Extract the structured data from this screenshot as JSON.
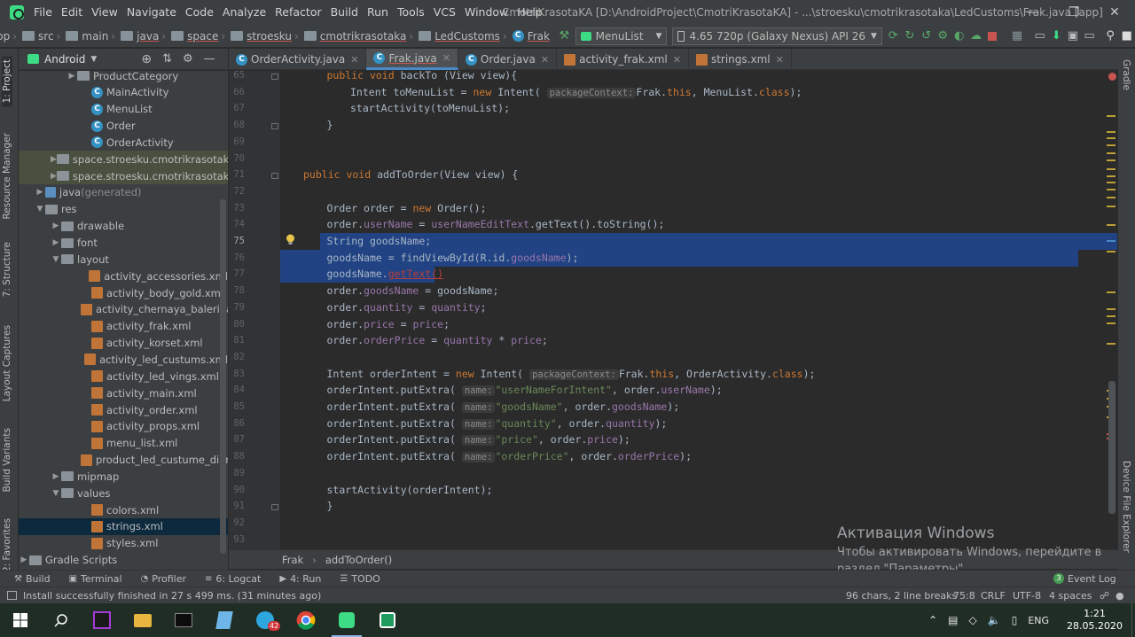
{
  "menubar": {
    "items": [
      "File",
      "Edit",
      "View",
      "Navigate",
      "Code",
      "Analyze",
      "Refactor",
      "Build",
      "Run",
      "Tools",
      "VCS",
      "Window",
      "Help"
    ],
    "window_title": "CmotriKrasotaKA [D:\\AndroidProject\\CmotriKrasotaKA] - ...\\stroesku\\cmotrikrasotaka\\LedCustoms\\Frak.java [app]"
  },
  "navbar": {
    "breadcrumbs": [
      "pp",
      "src",
      "main",
      "java",
      "space",
      "stroesku",
      "cmotrikrasotaka",
      "LedCustoms",
      "Frak"
    ],
    "run_config": "MenuList",
    "device": "4.65  720p (Galaxy Nexus) API 26"
  },
  "left_strip": {
    "tabs": [
      "1: Project",
      "Resource Manager",
      "7: Structure",
      "Layout Captures",
      "Build Variants",
      "2: Favorites"
    ]
  },
  "right_strip": {
    "tabs": [
      "Gradle",
      "Device File Explorer"
    ]
  },
  "project": {
    "view_label": "Android",
    "tree": [
      {
        "label": "ProductCategory",
        "icon": "folder",
        "arrow": "▶",
        "indent": 54
      },
      {
        "label": "MainActivity",
        "icon": "class",
        "arrow": "",
        "indent": 70
      },
      {
        "label": "MenuList",
        "icon": "class",
        "arrow": "",
        "indent": 70
      },
      {
        "label": "Order",
        "icon": "class",
        "arrow": "",
        "indent": 70
      },
      {
        "label": "OrderActivity",
        "icon": "class",
        "arrow": "",
        "indent": 70
      },
      {
        "label": "space.stroesku.cmotrikrasotaka",
        "suffix": " (a",
        "icon": "folder",
        "arrow": "▶",
        "indent": 36,
        "hl": true
      },
      {
        "label": "space.stroesku.cmotrikrasotaka",
        "suffix": " (t",
        "icon": "folder",
        "arrow": "▶",
        "indent": 36,
        "hl": true
      },
      {
        "label": "java",
        "suffix": " (generated)",
        "icon": "java",
        "arrow": "▶",
        "indent": 18
      },
      {
        "label": "res",
        "icon": "folder",
        "arrow": "▼",
        "indent": 18
      },
      {
        "label": "drawable",
        "icon": "folder",
        "arrow": "▶",
        "indent": 36
      },
      {
        "label": "font",
        "icon": "folder",
        "arrow": "▶",
        "indent": 36
      },
      {
        "label": "layout",
        "icon": "folder",
        "arrow": "▼",
        "indent": 36
      },
      {
        "label": "activity_accessories.xml",
        "icon": "xml",
        "arrow": "",
        "indent": 70
      },
      {
        "label": "activity_body_gold.xml",
        "icon": "xml",
        "arrow": "",
        "indent": 70
      },
      {
        "label": "activity_chernaya_balerina.xml",
        "icon": "xml",
        "arrow": "",
        "indent": 70
      },
      {
        "label": "activity_frak.xml",
        "icon": "xml",
        "arrow": "",
        "indent": 70
      },
      {
        "label": "activity_korset.xml",
        "icon": "xml",
        "arrow": "",
        "indent": 70
      },
      {
        "label": "activity_led_custums.xml",
        "icon": "xml",
        "arrow": "",
        "indent": 70
      },
      {
        "label": "activity_led_vings.xml",
        "icon": "xml",
        "arrow": "",
        "indent": 70
      },
      {
        "label": "activity_main.xml",
        "icon": "xml",
        "arrow": "",
        "indent": 70
      },
      {
        "label": "activity_order.xml",
        "icon": "xml",
        "arrow": "",
        "indent": 70
      },
      {
        "label": "activity_props.xml",
        "icon": "xml",
        "arrow": "",
        "indent": 70
      },
      {
        "label": "menu_list.xml",
        "icon": "xml",
        "arrow": "",
        "indent": 70
      },
      {
        "label": "product_led_custume_diamon",
        "icon": "xml",
        "arrow": "",
        "indent": 70
      },
      {
        "label": "mipmap",
        "icon": "folder",
        "arrow": "▶",
        "indent": 36
      },
      {
        "label": "values",
        "icon": "folder",
        "arrow": "▼",
        "indent": 36
      },
      {
        "label": "colors.xml",
        "icon": "xml",
        "arrow": "",
        "indent": 70
      },
      {
        "label": "strings.xml",
        "icon": "xml",
        "arrow": "",
        "indent": 70,
        "selected": true
      },
      {
        "label": "styles.xml",
        "icon": "xml",
        "arrow": "",
        "indent": 70
      },
      {
        "label": "Gradle Scripts",
        "icon": "folder",
        "arrow": "▶",
        "indent": 0
      }
    ]
  },
  "editor": {
    "tabs": [
      {
        "label": "OrderActivity.java",
        "icon": "C",
        "active": false
      },
      {
        "label": "Frak.java",
        "icon": "C",
        "active": true
      },
      {
        "label": "Order.java",
        "icon": "C",
        "active": false
      },
      {
        "label": "activity_frak.xml",
        "icon": "xml",
        "active": false
      },
      {
        "label": "strings.xml",
        "icon": "xml",
        "active": false
      }
    ],
    "lines": [
      {
        "n": "65",
        "i": 2,
        "t": [
          [
            "kw",
            "public void "
          ],
          [
            "",
            "backTo (View view){"
          ]
        ]
      },
      {
        "n": "66",
        "i": 3,
        "t": [
          [
            "",
            "Intent toMenuList = "
          ],
          [
            "kw",
            "new "
          ],
          [
            "",
            "Intent( "
          ],
          [
            "hint",
            "packageContext:"
          ],
          [
            "",
            "Frak."
          ],
          [
            "kw",
            "this"
          ],
          [
            "",
            ", MenuList."
          ],
          [
            "kw",
            "class"
          ],
          [
            "",
            ");"
          ]
        ]
      },
      {
        "n": "67",
        "i": 3,
        "t": [
          [
            "",
            "startActivity(toMenuList);"
          ]
        ]
      },
      {
        "n": "68",
        "i": 2,
        "t": [
          [
            "",
            "}"
          ]
        ]
      },
      {
        "n": "69",
        "i": 0,
        "t": []
      },
      {
        "n": "70",
        "i": 1,
        "t": []
      },
      {
        "n": "71",
        "i": 1,
        "t": [
          [
            "kw",
            "public void "
          ],
          [
            "",
            "addToOrder(View view) {"
          ]
        ]
      },
      {
        "n": "72",
        "i": 0,
        "t": []
      },
      {
        "n": "73",
        "i": 2,
        "t": [
          [
            "",
            "Order order = "
          ],
          [
            "kw",
            "new "
          ],
          [
            "",
            "Order();"
          ]
        ]
      },
      {
        "n": "74",
        "i": 2,
        "t": [
          [
            "",
            "order."
          ],
          [
            "fld",
            "userName"
          ],
          [
            "",
            " = "
          ],
          [
            "fld",
            "userNameEditText"
          ],
          [
            "",
            ".getText().toString();"
          ]
        ]
      },
      {
        "n": "75",
        "i": 2,
        "t": [
          [
            "",
            "String goodsName;"
          ]
        ]
      },
      {
        "n": "76",
        "i": 2,
        "t": [
          [
            "",
            "goodsName = findViewById(R.id."
          ],
          [
            "fld",
            "goodsName"
          ],
          [
            "",
            ");"
          ]
        ]
      },
      {
        "n": "77",
        "i": 2,
        "t": [
          [
            "",
            "goodsName."
          ],
          [
            "err",
            "getText()"
          ]
        ]
      },
      {
        "n": "78",
        "i": 2,
        "t": [
          [
            "",
            "order."
          ],
          [
            "fld",
            "goodsName"
          ],
          [
            "",
            " = goodsName;"
          ]
        ]
      },
      {
        "n": "79",
        "i": 2,
        "t": [
          [
            "",
            "order."
          ],
          [
            "fld",
            "quantity"
          ],
          [
            "",
            " = "
          ],
          [
            "fld",
            "quantity"
          ],
          [
            "",
            ";"
          ]
        ]
      },
      {
        "n": "80",
        "i": 2,
        "t": [
          [
            "",
            "order."
          ],
          [
            "fld",
            "price"
          ],
          [
            "",
            " = "
          ],
          [
            "fld",
            "price"
          ],
          [
            "",
            ";"
          ]
        ]
      },
      {
        "n": "81",
        "i": 2,
        "t": [
          [
            "",
            "order."
          ],
          [
            "fld",
            "orderPrice"
          ],
          [
            "",
            " = "
          ],
          [
            "fld",
            "quantity"
          ],
          [
            "",
            " * "
          ],
          [
            "fld",
            "price"
          ],
          [
            "",
            ";"
          ]
        ]
      },
      {
        "n": "82",
        "i": 0,
        "t": []
      },
      {
        "n": "83",
        "i": 2,
        "t": [
          [
            "",
            "Intent orderIntent = "
          ],
          [
            "kw",
            "new "
          ],
          [
            "",
            "Intent( "
          ],
          [
            "hint",
            "packageContext:"
          ],
          [
            "",
            "Frak."
          ],
          [
            "kw",
            "this"
          ],
          [
            "",
            ", OrderActivity."
          ],
          [
            "kw",
            "class"
          ],
          [
            "",
            ");"
          ]
        ]
      },
      {
        "n": "84",
        "i": 2,
        "t": [
          [
            "",
            "orderIntent.putExtra( "
          ],
          [
            "hint",
            "name:"
          ],
          [
            "str",
            "\"userNameForIntent\""
          ],
          [
            "",
            ", order."
          ],
          [
            "fld",
            "userName"
          ],
          [
            "",
            ");"
          ]
        ]
      },
      {
        "n": "85",
        "i": 2,
        "t": [
          [
            "",
            "orderIntent.putExtra( "
          ],
          [
            "hint",
            "name:"
          ],
          [
            "str",
            "\"goodsName\""
          ],
          [
            "",
            ", order."
          ],
          [
            "fld",
            "goodsName"
          ],
          [
            "",
            ");"
          ]
        ]
      },
      {
        "n": "86",
        "i": 2,
        "t": [
          [
            "",
            "orderIntent.putExtra( "
          ],
          [
            "hint",
            "name:"
          ],
          [
            "str",
            "\"quantity\""
          ],
          [
            "",
            ", order."
          ],
          [
            "fld",
            "quantity"
          ],
          [
            "",
            ");"
          ]
        ]
      },
      {
        "n": "87",
        "i": 2,
        "t": [
          [
            "",
            "orderIntent.putExtra( "
          ],
          [
            "hint",
            "name:"
          ],
          [
            "str",
            "\"price\""
          ],
          [
            "",
            ", order."
          ],
          [
            "fld",
            "price"
          ],
          [
            "",
            ");"
          ]
        ]
      },
      {
        "n": "88",
        "i": 2,
        "t": [
          [
            "",
            "orderIntent.putExtra( "
          ],
          [
            "hint",
            "name:"
          ],
          [
            "str",
            "\"orderPrice\""
          ],
          [
            "",
            ", order."
          ],
          [
            "fld",
            "orderPrice"
          ],
          [
            "",
            ");"
          ]
        ]
      },
      {
        "n": "89",
        "i": 0,
        "t": []
      },
      {
        "n": "90",
        "i": 2,
        "t": [
          [
            "",
            "startActivity(orderIntent);"
          ]
        ]
      },
      {
        "n": "91",
        "i": 2,
        "t": [
          [
            "",
            "}"
          ]
        ]
      },
      {
        "n": "92",
        "i": 0,
        "t": []
      },
      {
        "n": "93",
        "i": 0,
        "t": []
      }
    ],
    "breadcrumb": [
      "Frak",
      "addToOrder()"
    ]
  },
  "toolwindows": {
    "items": [
      {
        "icon": "⚒",
        "label": "Build"
      },
      {
        "icon": "▣",
        "label": "Terminal"
      },
      {
        "icon": "◔",
        "label": "Profiler"
      },
      {
        "icon": "≡",
        "label": "6: Logcat"
      },
      {
        "icon": "▶",
        "label": "4: Run"
      },
      {
        "icon": "☰",
        "label": "TODO"
      }
    ],
    "event_log_count": "3",
    "event_log_label": "Event Log"
  },
  "status": {
    "message": "Install successfully finished in 27 s 499 ms. (31 minutes ago)",
    "selection": "96 chars, 2 line breaks",
    "position": "75:8",
    "line_sep": "CRLF",
    "encoding": "UTF-8",
    "indent": "4 spaces"
  },
  "activation": {
    "title": "Активация Windows",
    "line1": "Чтобы активировать Windows, перейдите в",
    "line2": "раздел \"Параметры\"."
  },
  "taskbar": {
    "lang": "ENG",
    "time": "1:21",
    "date": "28.05.2020",
    "telegram_badge": "42"
  },
  "colors": {
    "selection": "#214283",
    "accent": "#4a88c7",
    "android_green": "#3ddc84"
  }
}
